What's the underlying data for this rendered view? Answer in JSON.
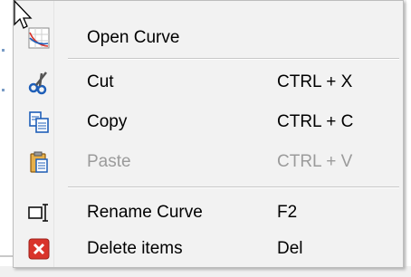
{
  "menu": {
    "items": [
      {
        "label": "Open Curve",
        "shortcut": "",
        "icon": "open-curve-icon",
        "enabled": true
      },
      {
        "label": "Cut",
        "shortcut": "CTRL + X",
        "icon": "scissors-icon",
        "enabled": true
      },
      {
        "label": "Copy",
        "shortcut": "CTRL + C",
        "icon": "copy-icon",
        "enabled": true
      },
      {
        "label": "Paste",
        "shortcut": "CTRL + V",
        "icon": "clipboard-icon",
        "enabled": false
      },
      {
        "label": "Rename Curve",
        "shortcut": "F2",
        "icon": "rename-icon",
        "enabled": true
      },
      {
        "label": "Delete items",
        "shortcut": "Del",
        "icon": "delete-icon",
        "enabled": true
      }
    ]
  },
  "colors": {
    "menu_background": "#f2f2f2",
    "disabled_text": "#9b9b9b",
    "delete_icon_red": "#d9342b",
    "icon_blue": "#1f5fb8"
  }
}
